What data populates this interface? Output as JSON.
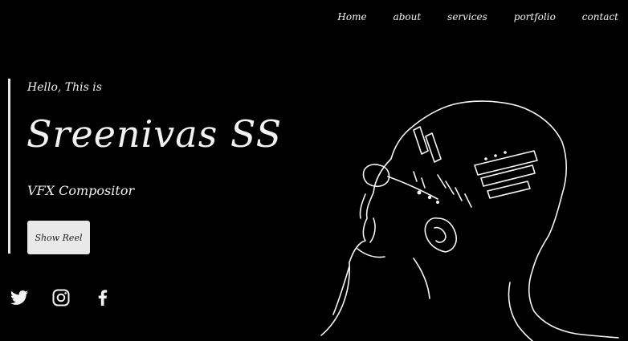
{
  "nav": {
    "items": [
      {
        "label": "Home"
      },
      {
        "label": "about"
      },
      {
        "label": "services"
      },
      {
        "label": "portfolio"
      },
      {
        "label": "contact"
      }
    ]
  },
  "hero": {
    "greeting": "Hello, This is",
    "name": "Sreenivas SS",
    "role": "VFX Compositor",
    "button_label": "Show Reel"
  },
  "social": {
    "icons": [
      "twitter-icon",
      "instagram-icon",
      "facebook-icon"
    ]
  },
  "colors": {
    "background": "#000000",
    "text": "#f2f2f2",
    "button_bg": "#e9e9e9",
    "button_text": "#222222"
  }
}
